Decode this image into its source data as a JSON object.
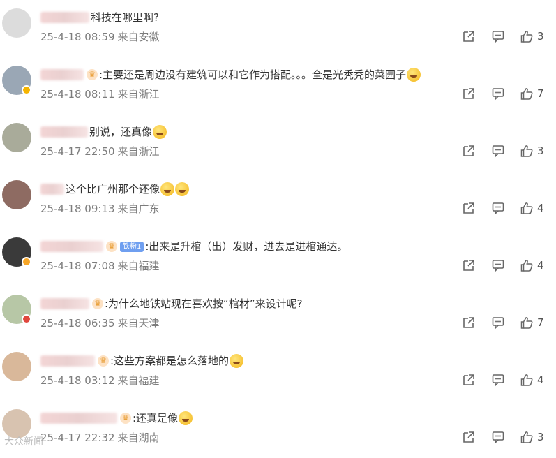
{
  "comments": [
    {
      "text": "科技在哪里啊?",
      "date": "25-4-18 08:59",
      "location": "来自安徽",
      "likes": "3",
      "avatar_color": "#dcdcdc",
      "badge": "",
      "prefix_crown": false,
      "fan_label": "",
      "emojis": 0
    },
    {
      "text": ":主要还是周边没有建筑可以和它作为搭配。。。全是光秃秃的菜园子",
      "date": "25-4-18 08:11",
      "location": "来自浙江",
      "likes": "7",
      "avatar_color": "#9aa7b5",
      "badge": "gold",
      "prefix_crown": true,
      "fan_label": "",
      "emojis": 1
    },
    {
      "text": "别说，还真像",
      "date": "25-4-17 22:50",
      "location": "来自浙江",
      "likes": "3",
      "avatar_color": "#a9ab9a",
      "badge": "",
      "prefix_crown": false,
      "fan_label": "",
      "emojis": 1
    },
    {
      "text": "这个比广州那个还像",
      "date": "25-4-18 09:13",
      "location": "来自广东",
      "likes": "4",
      "avatar_color": "#8e6b62",
      "badge": "",
      "prefix_crown": false,
      "fan_label": "",
      "emojis": 2
    },
    {
      "text": ":出来是升棺（出）发财，进去是进棺通达。",
      "date": "25-4-18 07:08",
      "location": "来自福建",
      "likes": "4",
      "avatar_color": "#3a3a3a",
      "badge": "orange",
      "prefix_crown": true,
      "fan_label": "铁粉1",
      "emojis": 0
    },
    {
      "text": ":为什么地铁站现在喜欢按“棺材”来设计呢?",
      "date": "25-4-18 06:35",
      "location": "来自天津",
      "likes": "7",
      "avatar_color": "#b7c7a6",
      "badge": "red",
      "prefix_crown": true,
      "fan_label": "",
      "emojis": 0
    },
    {
      "text": ":这些方案都是怎么落地的",
      "date": "25-4-18 03:12",
      "location": "来自福建",
      "likes": "4",
      "avatar_color": "#d9b89a",
      "badge": "",
      "prefix_crown": true,
      "fan_label": "",
      "emojis": 1
    },
    {
      "text": ":还真是像",
      "date": "25-4-17 22:32",
      "location": "来自湖南",
      "likes": "3",
      "avatar_color": "#d8c3b0",
      "badge": "",
      "prefix_crown": true,
      "fan_label": "",
      "emojis": 1
    }
  ],
  "watermark": "大众新闻",
  "icons": {
    "share": "share-icon",
    "reply": "comment-icon",
    "like": "thumbs-up-icon"
  }
}
